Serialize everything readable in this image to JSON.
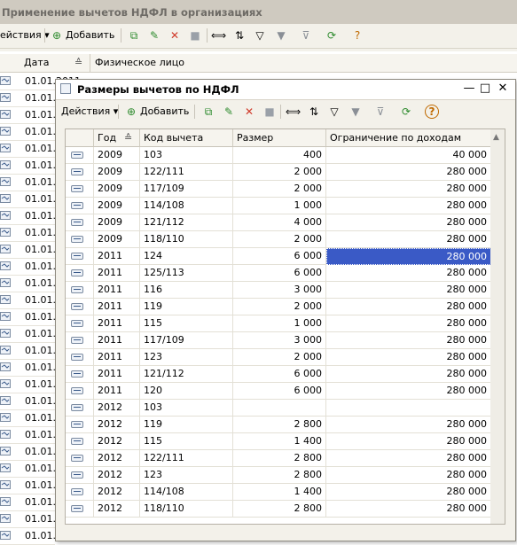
{
  "background_window": {
    "title": "Применение вычетов НДФЛ в организациях",
    "toolbar": {
      "actions_label": "ействия ▾",
      "add_label": "Добавить"
    },
    "columns": {
      "date": "Дата",
      "person": "Физическое лицо"
    },
    "row_dates": [
      "01.01.2011",
      "01.01.2",
      "01.01.2",
      "01.01.2",
      "01.01.2",
      "01.01.2",
      "01.01.2",
      "01.01.2",
      "01.01.2",
      "01.01.2",
      "01.01.2",
      "01.01.2",
      "01.01.2",
      "01.01.2",
      "01.01.2",
      "01.01.2",
      "01.01.2",
      "01.01.2",
      "01.01.2",
      "01.01.2",
      "01.01.2",
      "01.01.2",
      "01.01.2",
      "01.01.2",
      "01.01.2",
      "01.01.2",
      "01.01.2",
      "01.01.2"
    ]
  },
  "dialog": {
    "title": "Размеры вычетов по НДФЛ",
    "toolbar": {
      "actions_label": "Действия ▾",
      "add_label": "Добавить"
    },
    "columns": {
      "year": "Год",
      "code": "Код вычета",
      "amount": "Размер",
      "limit": "Ограничение по доходам"
    },
    "rows": [
      {
        "year": "2009",
        "code": "103",
        "amount": "400",
        "limit": "40 000"
      },
      {
        "year": "2009",
        "code": "122/111",
        "amount": "2 000",
        "limit": "280 000"
      },
      {
        "year": "2009",
        "code": "117/109",
        "amount": "2 000",
        "limit": "280 000"
      },
      {
        "year": "2009",
        "code": "114/108",
        "amount": "1 000",
        "limit": "280 000"
      },
      {
        "year": "2009",
        "code": "121/112",
        "amount": "4 000",
        "limit": "280 000"
      },
      {
        "year": "2009",
        "code": "118/110",
        "amount": "2 000",
        "limit": "280 000"
      },
      {
        "year": "2011",
        "code": "124",
        "amount": "6 000",
        "limit": "280 000"
      },
      {
        "year": "2011",
        "code": "125/113",
        "amount": "6 000",
        "limit": "280 000"
      },
      {
        "year": "2011",
        "code": "116",
        "amount": "3 000",
        "limit": "280 000"
      },
      {
        "year": "2011",
        "code": "119",
        "amount": "2 000",
        "limit": "280 000"
      },
      {
        "year": "2011",
        "code": "115",
        "amount": "1 000",
        "limit": "280 000"
      },
      {
        "year": "2011",
        "code": "117/109",
        "amount": "3 000",
        "limit": "280 000"
      },
      {
        "year": "2011",
        "code": "123",
        "amount": "2 000",
        "limit": "280 000"
      },
      {
        "year": "2011",
        "code": "121/112",
        "amount": "6 000",
        "limit": "280 000"
      },
      {
        "year": "2011",
        "code": "120",
        "amount": "6 000",
        "limit": "280 000"
      },
      {
        "year": "2012",
        "code": "103",
        "amount": "",
        "limit": ""
      },
      {
        "year": "2012",
        "code": "119",
        "amount": "2 800",
        "limit": "280 000"
      },
      {
        "year": "2012",
        "code": "115",
        "amount": "1 400",
        "limit": "280 000"
      },
      {
        "year": "2012",
        "code": "122/111",
        "amount": "2 800",
        "limit": "280 000"
      },
      {
        "year": "2012",
        "code": "123",
        "amount": "2 800",
        "limit": "280 000"
      },
      {
        "year": "2012",
        "code": "114/108",
        "amount": "1 400",
        "limit": "280 000"
      },
      {
        "year": "2012",
        "code": "118/110",
        "amount": "2 800",
        "limit": "280 000"
      }
    ],
    "selected_row": 6,
    "selected_column": "limit"
  },
  "colors": {
    "selection": "#3a5ac6",
    "window_bg": "#f3f1ea",
    "title_bg": "#cfcac0"
  }
}
